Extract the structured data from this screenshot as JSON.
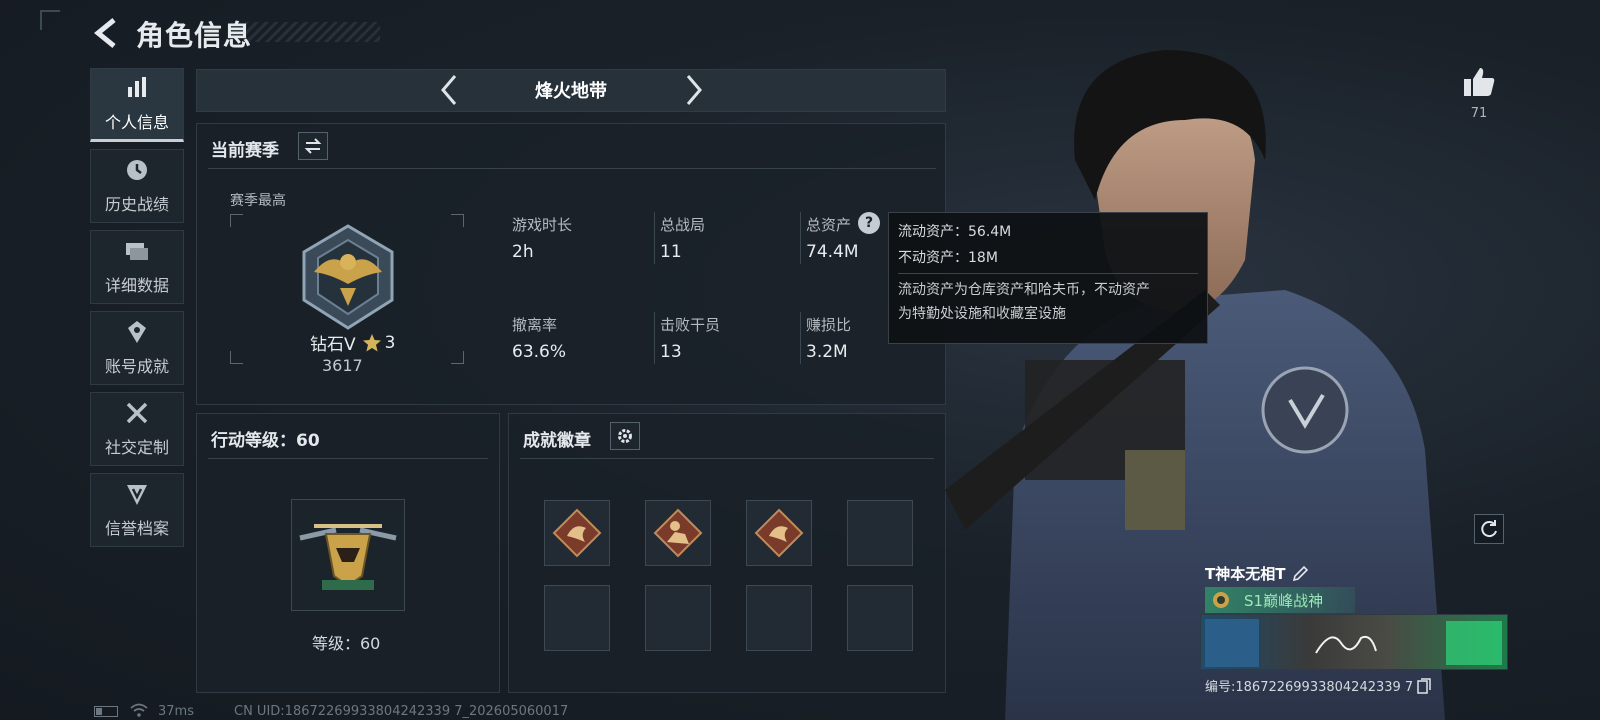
{
  "header": {
    "title": "角色信息"
  },
  "sidebar": {
    "items": [
      {
        "label": "个人信息",
        "icon": "bar-chart-icon",
        "active": true
      },
      {
        "label": "历史战绩",
        "icon": "clock-icon",
        "active": false
      },
      {
        "label": "详细数据",
        "icon": "stacked-cards-icon",
        "active": false
      },
      {
        "label": "账号成就",
        "icon": "medal-icon",
        "active": false
      },
      {
        "label": "社交定制",
        "icon": "wrench-icon",
        "active": false
      },
      {
        "label": "信誉档案",
        "icon": "shield-v-icon",
        "active": false
      }
    ]
  },
  "mode": {
    "name": "烽火地带"
  },
  "season": {
    "title": "当前赛季",
    "best_label": "赛季最高",
    "rank_name": "钻石V",
    "rank_stars": "3",
    "rank_score": "3617",
    "stats": [
      {
        "label": "游戏时长",
        "value": "2h"
      },
      {
        "label": "总战局",
        "value": "11"
      },
      {
        "label": "总资产",
        "value": "74.4M"
      },
      {
        "label": "撤离率",
        "value": "63.6%"
      },
      {
        "label": "击败干员",
        "value": "13"
      },
      {
        "label": "赚损比",
        "value": "3.2M"
      }
    ]
  },
  "tooltip": {
    "line1": "流动资产：56.4M",
    "line2": "不动资产：18M",
    "desc1": "流动资产为仓库资产和哈夫币，不动资产",
    "desc2": "为特勤处设施和收藏室设施"
  },
  "action_level": {
    "title": "行动等级：60",
    "level_label": "等级：60"
  },
  "badges": {
    "title": "成就徽章",
    "filled_slots": 3,
    "total_slots": 8
  },
  "profile": {
    "likes": "71",
    "player_name": "T神本无相T",
    "title_badge": "S1巅峰战神",
    "id_text": "编号:18672269933804242339 7"
  },
  "footer": {
    "ping": "37ms",
    "uid_text": "CN UID:18672269933804242339 7_202605060017"
  },
  "colors": {
    "accent_green": "#2fd67a",
    "gold": "#c9a24a",
    "badge_brown": "#7a3b2a"
  }
}
